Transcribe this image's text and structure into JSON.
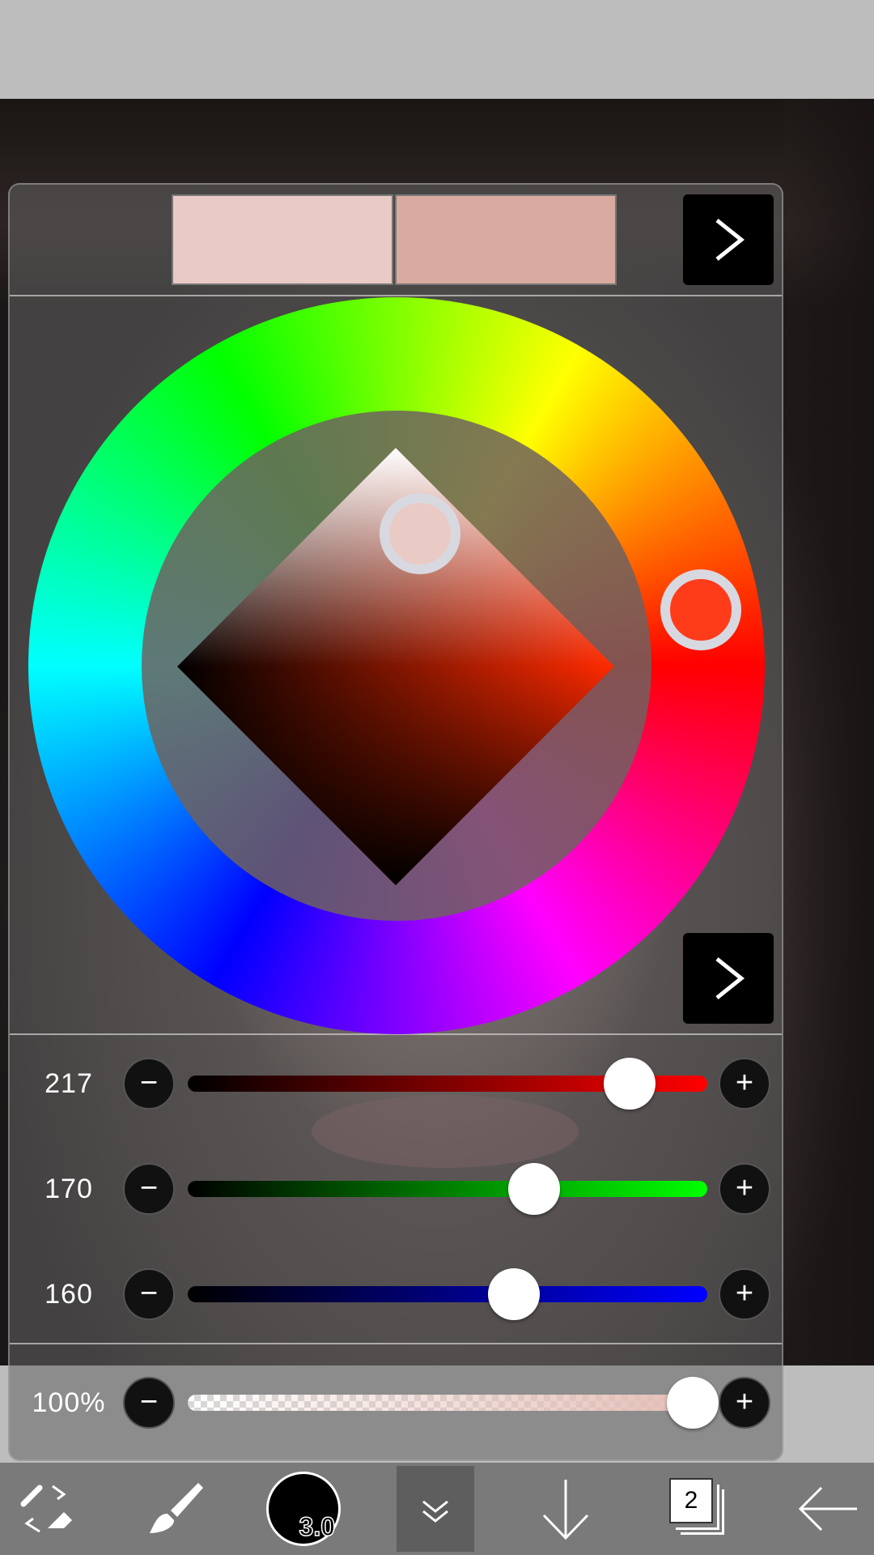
{
  "swatches": {
    "current_color": "#e9cac5",
    "previous_color": "#d9aaa0"
  },
  "color_picker": {
    "hue_color": "#ff3c1a"
  },
  "sliders": [
    {
      "name": "red",
      "value": "217",
      "fraction": 0.851,
      "track_from": "#000000",
      "track_to": "#ff0000"
    },
    {
      "name": "green",
      "value": "170",
      "fraction": 0.667,
      "track_from": "#000000",
      "track_to": "#00ff00"
    },
    {
      "name": "blue",
      "value": "160",
      "fraction": 0.627,
      "track_from": "#000000",
      "track_to": "#0000ff"
    }
  ],
  "opacity": {
    "value": "100%",
    "fraction": 1.0
  },
  "buttons": {
    "minus": "−",
    "plus": "+"
  },
  "toolbar": {
    "brush_size": "3.0",
    "layer_count": "2"
  }
}
